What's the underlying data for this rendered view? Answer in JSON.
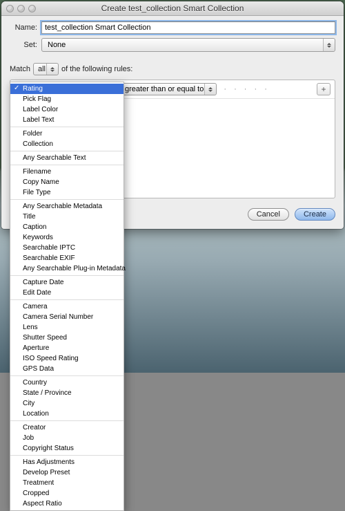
{
  "window": {
    "title": "Create test_collection Smart Collection"
  },
  "form": {
    "name_label": "Name:",
    "name_value": "test_collection Smart Collection",
    "set_label": "Set:",
    "set_value": "None"
  },
  "match": {
    "prefix": "Match",
    "mode": "all",
    "suffix": "of the following rules:"
  },
  "rule": {
    "attribute": "Rating",
    "operator": "is greater than or equal to",
    "value_display": "· · · · ·"
  },
  "buttons": {
    "cancel": "Cancel",
    "create": "Create"
  },
  "attribute_menu": {
    "selected_index": 0,
    "groups": [
      [
        "Rating",
        "Pick Flag",
        "Label Color",
        "Label Text"
      ],
      [
        "Folder",
        "Collection"
      ],
      [
        "Any Searchable Text"
      ],
      [
        "Filename",
        "Copy Name",
        "File Type"
      ],
      [
        "Any Searchable Metadata",
        "Title",
        "Caption",
        "Keywords",
        "Searchable IPTC",
        "Searchable EXIF",
        "Any Searchable Plug-in Metadata"
      ],
      [
        "Capture Date",
        "Edit Date"
      ],
      [
        "Camera",
        "Camera Serial Number",
        "Lens",
        "Shutter Speed",
        "Aperture",
        "ISO Speed Rating",
        "GPS Data"
      ],
      [
        "Country",
        "State / Province",
        "City",
        "Location"
      ],
      [
        "Creator",
        "Job",
        "Copyright Status"
      ],
      [
        "Has Adjustments",
        "Develop Preset",
        "Treatment",
        "Cropped",
        "Aspect Ratio"
      ]
    ]
  }
}
